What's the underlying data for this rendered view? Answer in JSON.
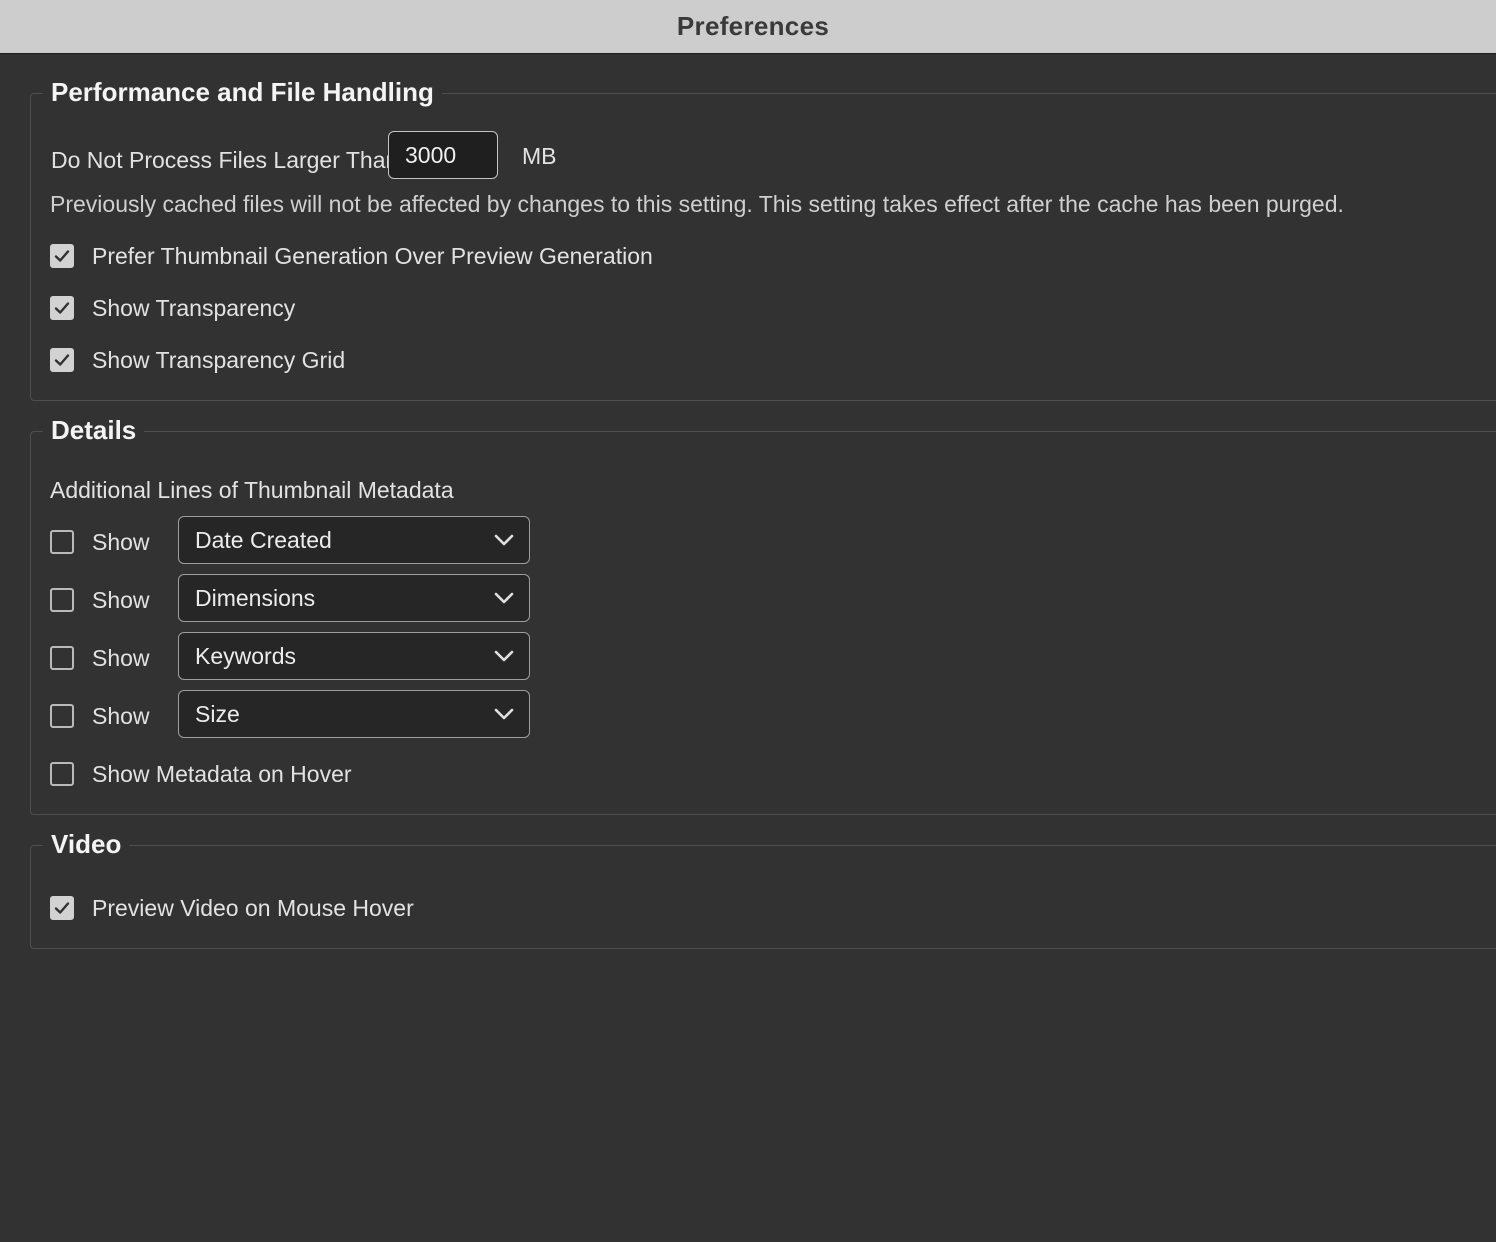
{
  "window": {
    "title": "Preferences"
  },
  "performance": {
    "heading": "Performance and File Handling",
    "max_file_label": "Do Not Process Files Larger Than",
    "max_file_value": "3000",
    "max_file_unit": "MB",
    "note": "Previously cached files will not be affected by changes to this setting. This setting takes effect after the cache has been purged.",
    "options": [
      {
        "label": "Prefer Thumbnail Generation Over Preview Generation",
        "checked": true
      },
      {
        "label": "Show Transparency",
        "checked": true
      },
      {
        "label": "Show Transparency Grid",
        "checked": true
      }
    ]
  },
  "details": {
    "heading": "Details",
    "subheading": "Additional Lines of Thumbnail Metadata",
    "lines": [
      {
        "show_label": "Show",
        "checked": false,
        "selected": "Date Created"
      },
      {
        "show_label": "Show",
        "checked": false,
        "selected": "Dimensions"
      },
      {
        "show_label": "Show",
        "checked": false,
        "selected": "Keywords"
      },
      {
        "show_label": "Show",
        "checked": false,
        "selected": "Size"
      }
    ],
    "hover_option": {
      "label": "Show Metadata on Hover",
      "checked": false
    }
  },
  "video": {
    "heading": "Video",
    "options": [
      {
        "label": "Preview Video on Mouse Hover",
        "checked": true
      }
    ]
  },
  "icons": {
    "check": "checkmark-icon",
    "dropdown": "chevron-down-icon"
  }
}
